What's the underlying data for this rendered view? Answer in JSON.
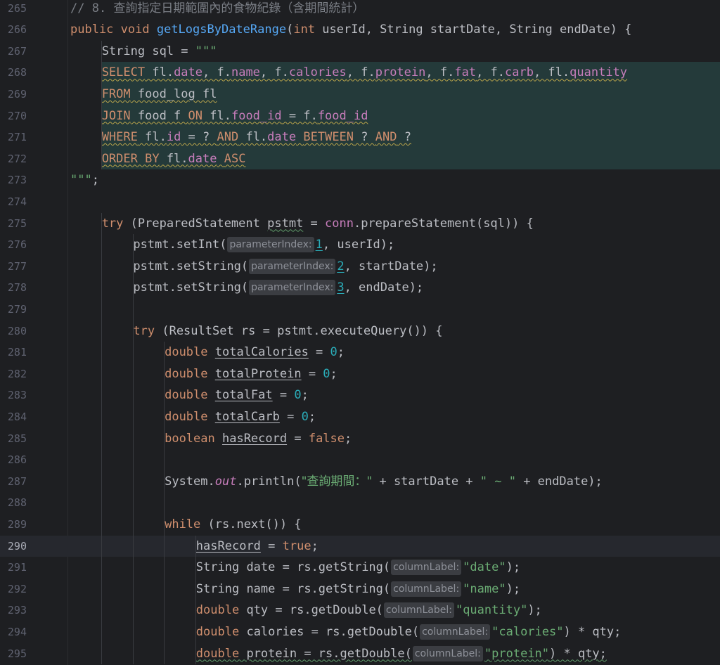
{
  "editor": {
    "current_line": "290",
    "lines": [
      {
        "num": "265",
        "indent": 1,
        "tokens": [
          {
            "t": "// 8. ",
            "c": "cm"
          },
          {
            "t": "查詢指定日期範圍內的食物紀錄（含期間統計）",
            "c": "cm cjk"
          }
        ]
      },
      {
        "num": "266",
        "indent": 1,
        "tokens": [
          {
            "t": "public ",
            "c": "kw"
          },
          {
            "t": "void ",
            "c": "kw"
          },
          {
            "t": "getLogsByDateRange",
            "c": "fn"
          },
          {
            "t": "(",
            "c": ""
          },
          {
            "t": "int ",
            "c": "kw"
          },
          {
            "t": "userId, String startDate, String endDate) {",
            "c": ""
          }
        ]
      },
      {
        "num": "267",
        "indent": 2,
        "tokens": [
          {
            "t": "String sql = ",
            "c": ""
          },
          {
            "t": "\"\"\"",
            "c": "str"
          }
        ]
      },
      {
        "num": "268",
        "indent": 2,
        "sql": true,
        "tokens": [
          {
            "t": "SELECT",
            "c": "kw wavy"
          },
          {
            "t": " fl.",
            "c": "wavy"
          },
          {
            "t": "date",
            "c": "fld wavy"
          },
          {
            "t": ", f.",
            "c": "wavy"
          },
          {
            "t": "name",
            "c": "fld wavy"
          },
          {
            "t": ", f.",
            "c": "wavy"
          },
          {
            "t": "calories",
            "c": "fld wavy"
          },
          {
            "t": ", f.",
            "c": "wavy"
          },
          {
            "t": "protein",
            "c": "fld wavy"
          },
          {
            "t": ", f.",
            "c": "wavy"
          },
          {
            "t": "fat",
            "c": "fld wavy"
          },
          {
            "t": ", f.",
            "c": "wavy"
          },
          {
            "t": "carb",
            "c": "fld wavy"
          },
          {
            "t": ", fl.",
            "c": "wavy"
          },
          {
            "t": "quantity",
            "c": "fld wavy"
          }
        ]
      },
      {
        "num": "269",
        "indent": 2,
        "sql": true,
        "tokens": [
          {
            "t": "FROM",
            "c": "kw wavy"
          },
          {
            "t": " food_log fl",
            "c": "wavy"
          }
        ]
      },
      {
        "num": "270",
        "indent": 2,
        "sql": true,
        "tokens": [
          {
            "t": "JOIN",
            "c": "kw wavy"
          },
          {
            "t": " food f ",
            "c": "wavy"
          },
          {
            "t": "ON",
            "c": "kw wavy"
          },
          {
            "t": " fl.",
            "c": "wavy"
          },
          {
            "t": "food_id",
            "c": "fld wavy"
          },
          {
            "t": " = f.",
            "c": "wavy"
          },
          {
            "t": "food_id",
            "c": "fld wavy"
          }
        ]
      },
      {
        "num": "271",
        "indent": 2,
        "sql": true,
        "tokens": [
          {
            "t": "WHERE",
            "c": "kw wavy"
          },
          {
            "t": " fl.",
            "c": "wavy"
          },
          {
            "t": "id",
            "c": "fld wavy"
          },
          {
            "t": " = ? ",
            "c": "wavy"
          },
          {
            "t": "AND",
            "c": "kw wavy"
          },
          {
            "t": " fl.",
            "c": "wavy"
          },
          {
            "t": "date",
            "c": "fld wavy"
          },
          {
            "t": " ",
            "c": "wavy"
          },
          {
            "t": "BETWEEN",
            "c": "kw wavy"
          },
          {
            "t": " ? ",
            "c": "wavy"
          },
          {
            "t": "AND",
            "c": "kw wavy"
          },
          {
            "t": " ?",
            "c": "wavy"
          }
        ]
      },
      {
        "num": "272",
        "indent": 2,
        "sql": true,
        "tokens": [
          {
            "t": "ORDER BY",
            "c": "kw wavy"
          },
          {
            "t": " fl.",
            "c": "wavy"
          },
          {
            "t": "date",
            "c": "fld wavy"
          },
          {
            "t": " ",
            "c": "wavy"
          },
          {
            "t": "ASC",
            "c": "kw wavy"
          }
        ]
      },
      {
        "num": "273",
        "indent": 1,
        "tokens": [
          {
            "t": "\"\"\"",
            "c": "str"
          },
          {
            "t": ";",
            "c": ""
          }
        ]
      },
      {
        "num": "274",
        "indent": 0,
        "tokens": []
      },
      {
        "num": "275",
        "indent": 2,
        "tokens": [
          {
            "t": "try ",
            "c": "kw"
          },
          {
            "t": "(PreparedStatement ",
            "c": ""
          },
          {
            "t": "pstmt",
            "c": "wavy-g"
          },
          {
            "t": " = ",
            "c": ""
          },
          {
            "t": "conn",
            "c": "fld"
          },
          {
            "t": ".prepareStatement(sql)) {",
            "c": ""
          }
        ]
      },
      {
        "num": "276",
        "indent": 3,
        "tokens": [
          {
            "t": "pstmt.setInt(",
            "c": ""
          },
          {
            "hint": "parameterIndex:"
          },
          {
            "t": "1",
            "c": "num ul"
          },
          {
            "t": ", userId);",
            "c": ""
          }
        ]
      },
      {
        "num": "277",
        "indent": 3,
        "tokens": [
          {
            "t": "pstmt.setString(",
            "c": ""
          },
          {
            "hint": "parameterIndex:"
          },
          {
            "t": "2",
            "c": "num ul"
          },
          {
            "t": ", startDate);",
            "c": ""
          }
        ]
      },
      {
        "num": "278",
        "indent": 3,
        "tokens": [
          {
            "t": "pstmt.setString(",
            "c": ""
          },
          {
            "hint": "parameterIndex:"
          },
          {
            "t": "3",
            "c": "num ul"
          },
          {
            "t": ", endDate);",
            "c": ""
          }
        ]
      },
      {
        "num": "279",
        "indent": 0,
        "tokens": []
      },
      {
        "num": "280",
        "indent": 3,
        "tokens": [
          {
            "t": "try ",
            "c": "kw"
          },
          {
            "t": "(ResultSet rs = pstmt.executeQuery()) {",
            "c": ""
          }
        ]
      },
      {
        "num": "281",
        "indent": 4,
        "tokens": [
          {
            "t": "double ",
            "c": "kw"
          },
          {
            "t": "totalCalories",
            "c": "ul"
          },
          {
            "t": " = ",
            "c": ""
          },
          {
            "t": "0",
            "c": "num"
          },
          {
            "t": ";",
            "c": ""
          }
        ]
      },
      {
        "num": "282",
        "indent": 4,
        "tokens": [
          {
            "t": "double ",
            "c": "kw"
          },
          {
            "t": "totalProtein",
            "c": "ul"
          },
          {
            "t": " = ",
            "c": ""
          },
          {
            "t": "0",
            "c": "num"
          },
          {
            "t": ";",
            "c": ""
          }
        ]
      },
      {
        "num": "283",
        "indent": 4,
        "tokens": [
          {
            "t": "double ",
            "c": "kw"
          },
          {
            "t": "totalFat",
            "c": "ul"
          },
          {
            "t": " = ",
            "c": ""
          },
          {
            "t": "0",
            "c": "num"
          },
          {
            "t": ";",
            "c": ""
          }
        ]
      },
      {
        "num": "284",
        "indent": 4,
        "tokens": [
          {
            "t": "double ",
            "c": "kw"
          },
          {
            "t": "totalCarb",
            "c": "ul"
          },
          {
            "t": " = ",
            "c": ""
          },
          {
            "t": "0",
            "c": "num"
          },
          {
            "t": ";",
            "c": ""
          }
        ]
      },
      {
        "num": "285",
        "indent": 4,
        "tokens": [
          {
            "t": "boolean ",
            "c": "kw"
          },
          {
            "t": "hasRecord",
            "c": "ul"
          },
          {
            "t": " = ",
            "c": ""
          },
          {
            "t": "false",
            "c": "kw"
          },
          {
            "t": ";",
            "c": ""
          }
        ]
      },
      {
        "num": "286",
        "indent": 0,
        "tokens": []
      },
      {
        "num": "287",
        "indent": 4,
        "tokens": [
          {
            "t": "System.",
            "c": ""
          },
          {
            "t": "out",
            "c": "stat"
          },
          {
            "t": ".println(",
            "c": ""
          },
          {
            "t": "\"查詢期間：\"",
            "c": "str cjk"
          },
          {
            "t": " + startDate + ",
            "c": ""
          },
          {
            "t": "\" ~ \"",
            "c": "str"
          },
          {
            "t": " + endDate);",
            "c": ""
          }
        ]
      },
      {
        "num": "288",
        "indent": 0,
        "tokens": []
      },
      {
        "num": "289",
        "indent": 4,
        "tokens": [
          {
            "t": "while ",
            "c": "kw"
          },
          {
            "t": "(rs.next()) {",
            "c": ""
          }
        ]
      },
      {
        "num": "290",
        "indent": 5,
        "tokens": [
          {
            "t": "hasRecord",
            "c": "ul"
          },
          {
            "t": " = ",
            "c": ""
          },
          {
            "t": "true",
            "c": "kw"
          },
          {
            "t": ";",
            "c": ""
          }
        ]
      },
      {
        "num": "291",
        "indent": 5,
        "tokens": [
          {
            "t": "String date = rs.getString(",
            "c": ""
          },
          {
            "hint": "columnLabel:"
          },
          {
            "t": "\"date\"",
            "c": "str"
          },
          {
            "t": ");",
            "c": ""
          }
        ]
      },
      {
        "num": "292",
        "indent": 5,
        "tokens": [
          {
            "t": "String name = rs.getString(",
            "c": ""
          },
          {
            "hint": "columnLabel:"
          },
          {
            "t": "\"name\"",
            "c": "str"
          },
          {
            "t": ");",
            "c": ""
          }
        ]
      },
      {
        "num": "293",
        "indent": 5,
        "tokens": [
          {
            "t": "double ",
            "c": "kw"
          },
          {
            "t": "qty = rs.getDouble(",
            "c": ""
          },
          {
            "hint": "columnLabel:"
          },
          {
            "t": "\"quantity\"",
            "c": "str"
          },
          {
            "t": ");",
            "c": ""
          }
        ]
      },
      {
        "num": "294",
        "indent": 5,
        "tokens": [
          {
            "t": "double ",
            "c": "kw"
          },
          {
            "t": "calories = rs.getDouble(",
            "c": ""
          },
          {
            "hint": "columnLabel:"
          },
          {
            "t": "\"calories\"",
            "c": "str"
          },
          {
            "t": ") * qty;",
            "c": ""
          }
        ]
      },
      {
        "num": "295",
        "indent": 5,
        "tokens": [
          {
            "t": "double ",
            "c": "kw wavy-g"
          },
          {
            "t": "protein = rs.getDouble(",
            "c": "wavy-g"
          },
          {
            "hint": "columnLabel:"
          },
          {
            "t": "\"protein\"",
            "c": "str wavy-g"
          },
          {
            "t": ") * qty;",
            "c": "wavy-g"
          }
        ]
      }
    ]
  }
}
